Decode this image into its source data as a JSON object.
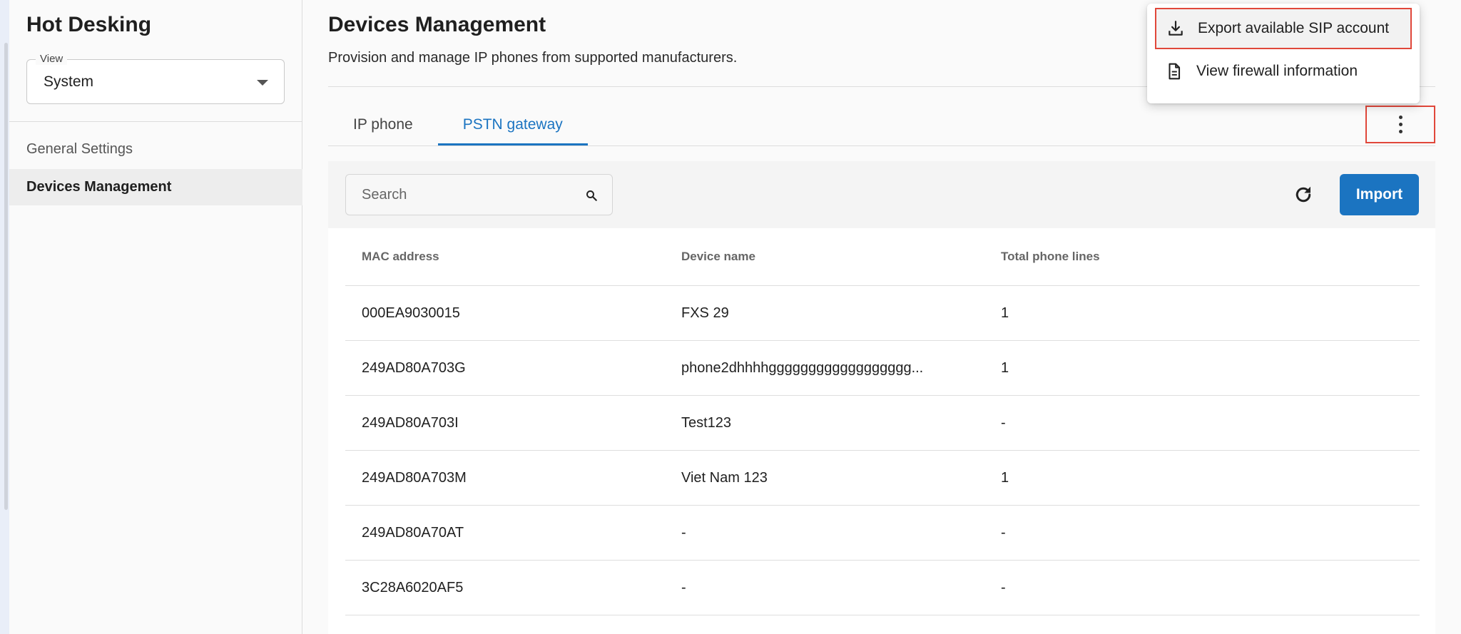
{
  "app": {
    "title": "Hot Desking"
  },
  "sidebar": {
    "view_label": "View",
    "view_value": "System",
    "items": [
      {
        "label": "General Settings"
      },
      {
        "label": "Devices Management"
      }
    ]
  },
  "page": {
    "title": "Devices Management",
    "subtitle": "Provision and manage IP phones from supported manufacturers."
  },
  "tabs": [
    {
      "label": "IP phone"
    },
    {
      "label": "PSTN gateway"
    }
  ],
  "toolbar": {
    "search_placeholder": "Search",
    "import_label": "Import"
  },
  "table": {
    "headers": [
      "MAC address",
      "Device name",
      "Total phone lines"
    ],
    "rows": [
      [
        "000EA9030015",
        "FXS 29",
        "1"
      ],
      [
        "249AD80A703G",
        "phone2dhhhhgggggggggggggggggg...",
        "1"
      ],
      [
        "249AD80A703I",
        "Test123",
        "-"
      ],
      [
        "249AD80A703M",
        "Viet Nam 123",
        "1"
      ],
      [
        "249AD80A70AT",
        "-",
        "-"
      ],
      [
        "3C28A6020AF5",
        "-",
        "-"
      ]
    ]
  },
  "menu": {
    "items": [
      {
        "label": "Export available SIP account",
        "icon": "download-icon"
      },
      {
        "label": "View firewall information",
        "icon": "document-icon"
      }
    ]
  },
  "colors": {
    "accent": "#1b74c1",
    "highlight_border": "#e0473a"
  }
}
